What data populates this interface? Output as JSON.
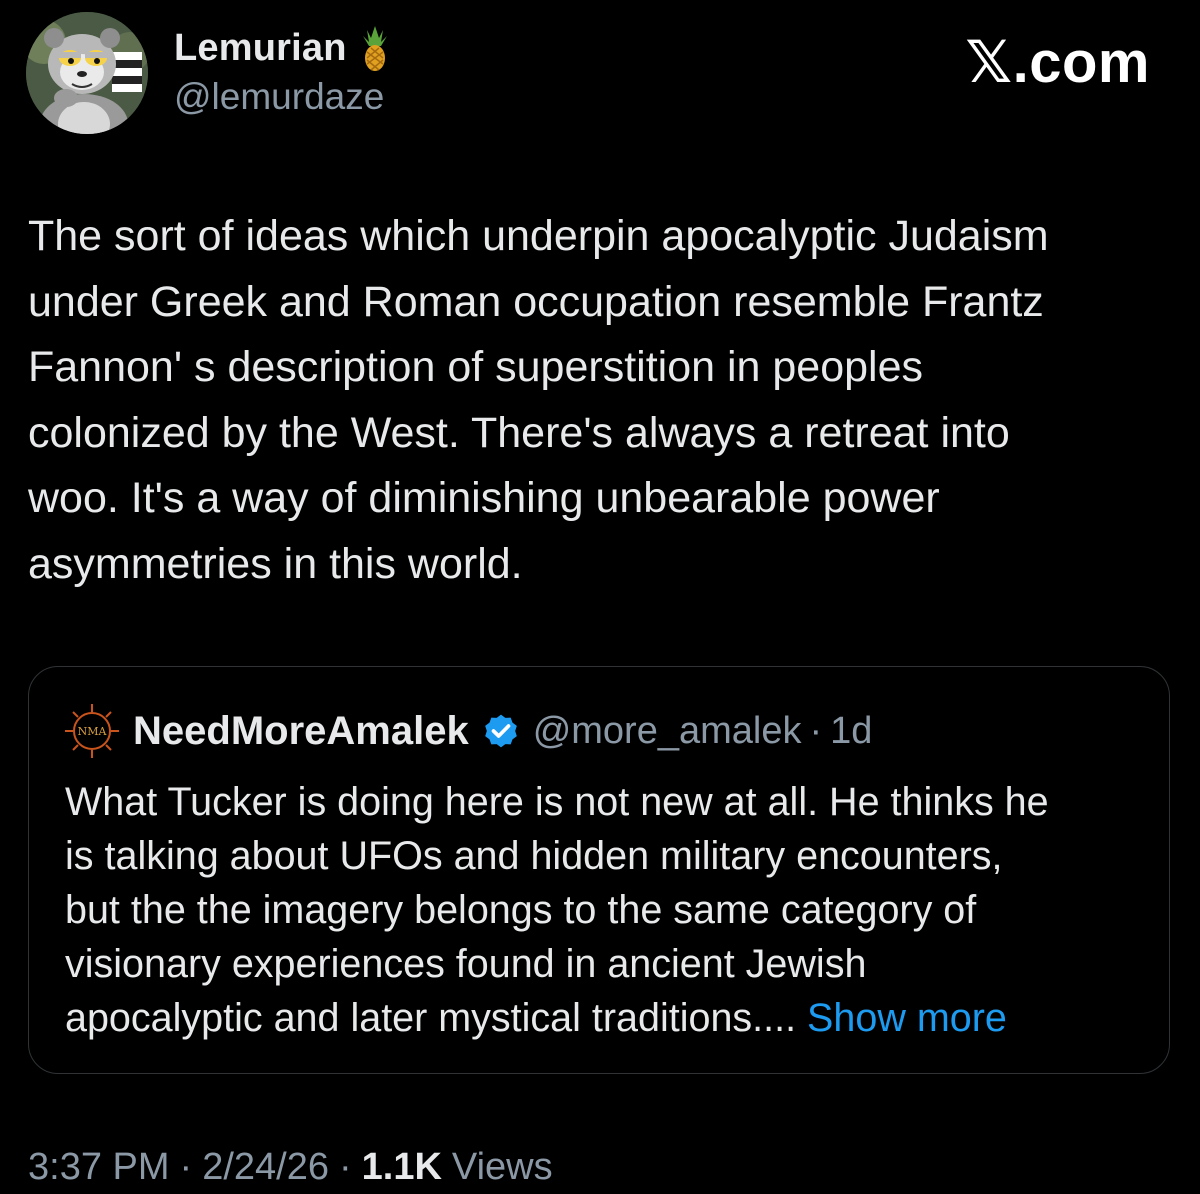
{
  "post": {
    "author": {
      "display_name": "Lemurian",
      "badge_emoji_icon": "pineapple-icon",
      "handle": "@lemurdaze",
      "avatar_icon": "lemur-cartoon-avatar"
    },
    "brand": "𝕏.com",
    "text": "The sort of ideas which underpin apocalyptic Judaism\nunder Greek and Roman occupation resemble Frantz\nFannon' s description of superstition in peoples\ncolonized by the West. There's always a retreat into\nwoo. It's a way of diminishing unbearable power\nasymmetries in this world.",
    "quote": {
      "avatar_icon": "nma-logo",
      "avatar_text": "NMA",
      "display_name": "NeedMoreAmalek",
      "verified_icon": "verified-badge-icon",
      "handle": "@more_amalek",
      "separator": "·",
      "time": "1d",
      "text": "What Tucker is doing here is not new at all. He thinks he\nis talking about UFOs and hidden military encounters,\nbut the the imagery belongs to the same category of\nvisionary experiences found in ancient Jewish\napocalyptic and later mystical traditions....",
      "show_more": " Show more"
    },
    "meta": {
      "time": "3:37 PM",
      "sep1": "·",
      "date": "2/24/26",
      "sep2": "·",
      "views_count": "1.1K",
      "views_label": "Views"
    }
  },
  "colors": {
    "background": "#000000",
    "text_primary": "#e7e9ea",
    "text_secondary": "#8b98a5",
    "link": "#1d9bf0",
    "border": "#2f3336",
    "verified": "#1d9bf0"
  }
}
